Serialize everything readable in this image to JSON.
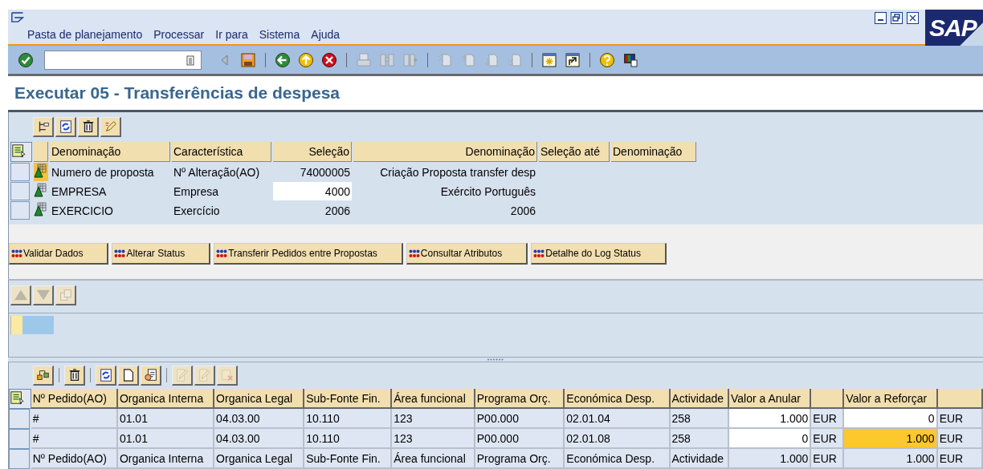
{
  "window": {
    "logo": "SAP"
  },
  "menu": [
    "Pasta de planejamento",
    "Processar",
    "Ir para",
    "Sistema",
    "Ajuda"
  ],
  "toolbar": [
    {
      "kind": "enter",
      "disabled": false
    },
    {
      "kind": "field"
    },
    {
      "kind": "nav-left",
      "disabled": true
    },
    {
      "kind": "save",
      "disabled": false
    },
    {
      "kind": "separator"
    },
    {
      "kind": "back",
      "disabled": false
    },
    {
      "kind": "exit",
      "disabled": false
    },
    {
      "kind": "cancel",
      "disabled": false
    },
    {
      "kind": "separator"
    },
    {
      "kind": "print",
      "disabled": true
    },
    {
      "kind": "find",
      "disabled": true
    },
    {
      "kind": "find-next",
      "disabled": true
    },
    {
      "kind": "separator"
    },
    {
      "kind": "first-page",
      "disabled": true
    },
    {
      "kind": "prev-page",
      "disabled": true
    },
    {
      "kind": "next-page",
      "disabled": true
    },
    {
      "kind": "last-page",
      "disabled": true
    },
    {
      "kind": "separator"
    },
    {
      "kind": "new-session",
      "disabled": false
    },
    {
      "kind": "shortcut",
      "disabled": false
    },
    {
      "kind": "separator"
    },
    {
      "kind": "help",
      "disabled": false
    },
    {
      "kind": "layout",
      "disabled": false
    }
  ],
  "title": "Executar 05 - Transferências de despesa",
  "selection_panel": {
    "tools": [
      {
        "kind": "hierarchy",
        "disabled": false
      },
      {
        "kind": "refresh",
        "disabled": false
      },
      {
        "kind": "delete",
        "disabled": false
      },
      {
        "kind": "pencil",
        "disabled": false
      }
    ],
    "columns": [
      "Denominação",
      "Característica",
      "Seleção",
      "Denominação",
      "Seleção até",
      "Denominação"
    ],
    "rows": [
      {
        "current": true,
        "editable": false,
        "cells": [
          "Numero de proposta",
          "Nº Alteração(AO)",
          "74000005",
          "Criação Proposta  transfer desp"
        ]
      },
      {
        "current": false,
        "editable": true,
        "cells": [
          "EMPRESA",
          "Empresa",
          "4000",
          "Exército Português"
        ]
      },
      {
        "current": false,
        "editable": false,
        "cells": [
          "EXERCICIO",
          "Exercício",
          "2006",
          "2006"
        ]
      }
    ]
  },
  "actions": [
    "Validar Dados",
    "Alterar Status",
    "Transferir Pedidos entre Propostas",
    "Consultar Atributos",
    "Detalhe do Log Status"
  ],
  "detail_panel": {
    "tools": [
      {
        "kind": "up",
        "disabled": true
      },
      {
        "kind": "down",
        "disabled": true
      },
      {
        "kind": "copy",
        "disabled": true
      }
    ]
  },
  "items_panel": {
    "tools": [
      {
        "kind": "group",
        "disabled": false
      },
      {
        "kind": "separator"
      },
      {
        "kind": "delete",
        "disabled": false
      },
      {
        "kind": "separator"
      },
      {
        "kind": "refresh",
        "disabled": false
      },
      {
        "kind": "new-doc",
        "disabled": false
      },
      {
        "kind": "form",
        "disabled": false
      },
      {
        "kind": "separator"
      },
      {
        "kind": "edit",
        "disabled": true
      },
      {
        "kind": "edit",
        "disabled": true
      },
      {
        "kind": "delete-row",
        "disabled": true
      }
    ],
    "columns": [
      {
        "label": "Nº Pedido(AO)"
      },
      {
        "label": "Organica Interna"
      },
      {
        "label": "Organica Legal"
      },
      {
        "label": "Sub-Fonte Fin."
      },
      {
        "label": "Área funcional"
      },
      {
        "label": "Programa Orç."
      },
      {
        "label": "Económica Desp."
      },
      {
        "label": "Actividade"
      },
      {
        "label": "Valor a Anular"
      },
      {
        "kind": "currency"
      },
      {
        "label": "Valor a Reforçar"
      },
      {
        "kind": "currency"
      }
    ],
    "rows": [
      {
        "cells": [
          {
            "text": "#",
            "kind": "text"
          },
          {
            "text": "01.01",
            "kind": "text"
          },
          {
            "text": "04.03.00",
            "kind": "text"
          },
          {
            "text": "10.110",
            "kind": "text"
          },
          {
            "text": "123",
            "kind": "text"
          },
          {
            "text": "P00.000",
            "kind": "text"
          },
          {
            "text": "02.01.04",
            "kind": "text"
          },
          {
            "text": "258",
            "kind": "text"
          },
          {
            "text": "1.000",
            "kind": "input",
            "highlighted": false
          },
          {
            "text": "EUR",
            "kind": "text"
          },
          {
            "text": "0",
            "kind": "input",
            "highlighted": false
          },
          {
            "text": "EUR",
            "kind": "text"
          }
        ]
      },
      {
        "cells": [
          {
            "text": "#",
            "kind": "text"
          },
          {
            "text": "01.01",
            "kind": "text"
          },
          {
            "text": "04.03.00",
            "kind": "text"
          },
          {
            "text": "10.110",
            "kind": "text"
          },
          {
            "text": "123",
            "kind": "text"
          },
          {
            "text": "P00.000",
            "kind": "text"
          },
          {
            "text": "02.01.08",
            "kind": "text"
          },
          {
            "text": "258",
            "kind": "text"
          },
          {
            "text": "0",
            "kind": "input",
            "highlighted": false
          },
          {
            "text": "EUR",
            "kind": "text"
          },
          {
            "text": "1.000",
            "kind": "input",
            "highlighted": true
          },
          {
            "text": "EUR",
            "kind": "text"
          }
        ]
      },
      {
        "cells": [
          {
            "text": "Nº Pedido(AO)",
            "kind": "text"
          },
          {
            "text": "Organica Interna",
            "kind": "text"
          },
          {
            "text": "Organica Legal",
            "kind": "text"
          },
          {
            "text": "Sub-Fonte Fin.",
            "kind": "text"
          },
          {
            "text": "Área funcional",
            "kind": "text"
          },
          {
            "text": "Programa Orç.",
            "kind": "text"
          },
          {
            "text": "Económica Desp.",
            "kind": "text"
          },
          {
            "text": "Actividade",
            "kind": "text"
          },
          {
            "text": "1.000",
            "kind": "amount"
          },
          {
            "text": "EUR",
            "kind": "text"
          },
          {
            "text": "1.000",
            "kind": "amount"
          },
          {
            "text": "EUR",
            "kind": "text"
          }
        ]
      }
    ]
  }
}
